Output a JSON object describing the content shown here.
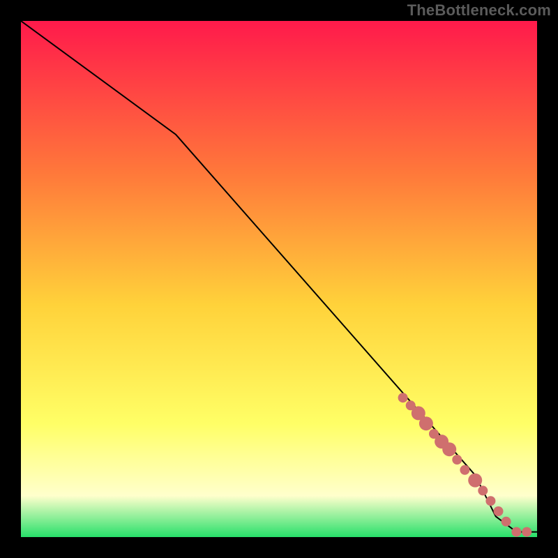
{
  "watermark": "TheBottleneck.com",
  "colors": {
    "page_bg": "#000000",
    "gradient_top": "#ff1a4b",
    "gradient_mid_upper": "#ff7a3a",
    "gradient_mid": "#ffd23a",
    "gradient_mid_lower": "#ffff66",
    "gradient_pale": "#ffffcc",
    "gradient_bottom": "#27e06a",
    "line": "#000000",
    "marker_fill": "#cf6f6e",
    "marker_stroke": "#cf6f6e"
  },
  "chart_data": {
    "type": "line",
    "title": "",
    "xlabel": "",
    "ylabel": "",
    "xlim": [
      0,
      100
    ],
    "ylim": [
      0,
      100
    ],
    "grid": false,
    "series": [
      {
        "name": "curve",
        "x": [
          0,
          30,
          88,
          92,
          96,
          100
        ],
        "y": [
          100,
          78,
          12,
          4,
          1,
          1
        ]
      }
    ],
    "markers": {
      "name": "highlight-points",
      "x": [
        74,
        75.5,
        77,
        78.5,
        80,
        81.5,
        83,
        84.5,
        86,
        88,
        89.5,
        91,
        92.5,
        94,
        96,
        98
      ],
      "y": [
        27,
        25.5,
        24,
        22,
        20,
        18.5,
        17,
        15,
        13,
        11,
        9,
        7,
        5,
        3,
        1,
        1
      ],
      "size": [
        7,
        7,
        10,
        10,
        7,
        10,
        10,
        7,
        7,
        10,
        7,
        7,
        7,
        7,
        7,
        7
      ]
    }
  }
}
